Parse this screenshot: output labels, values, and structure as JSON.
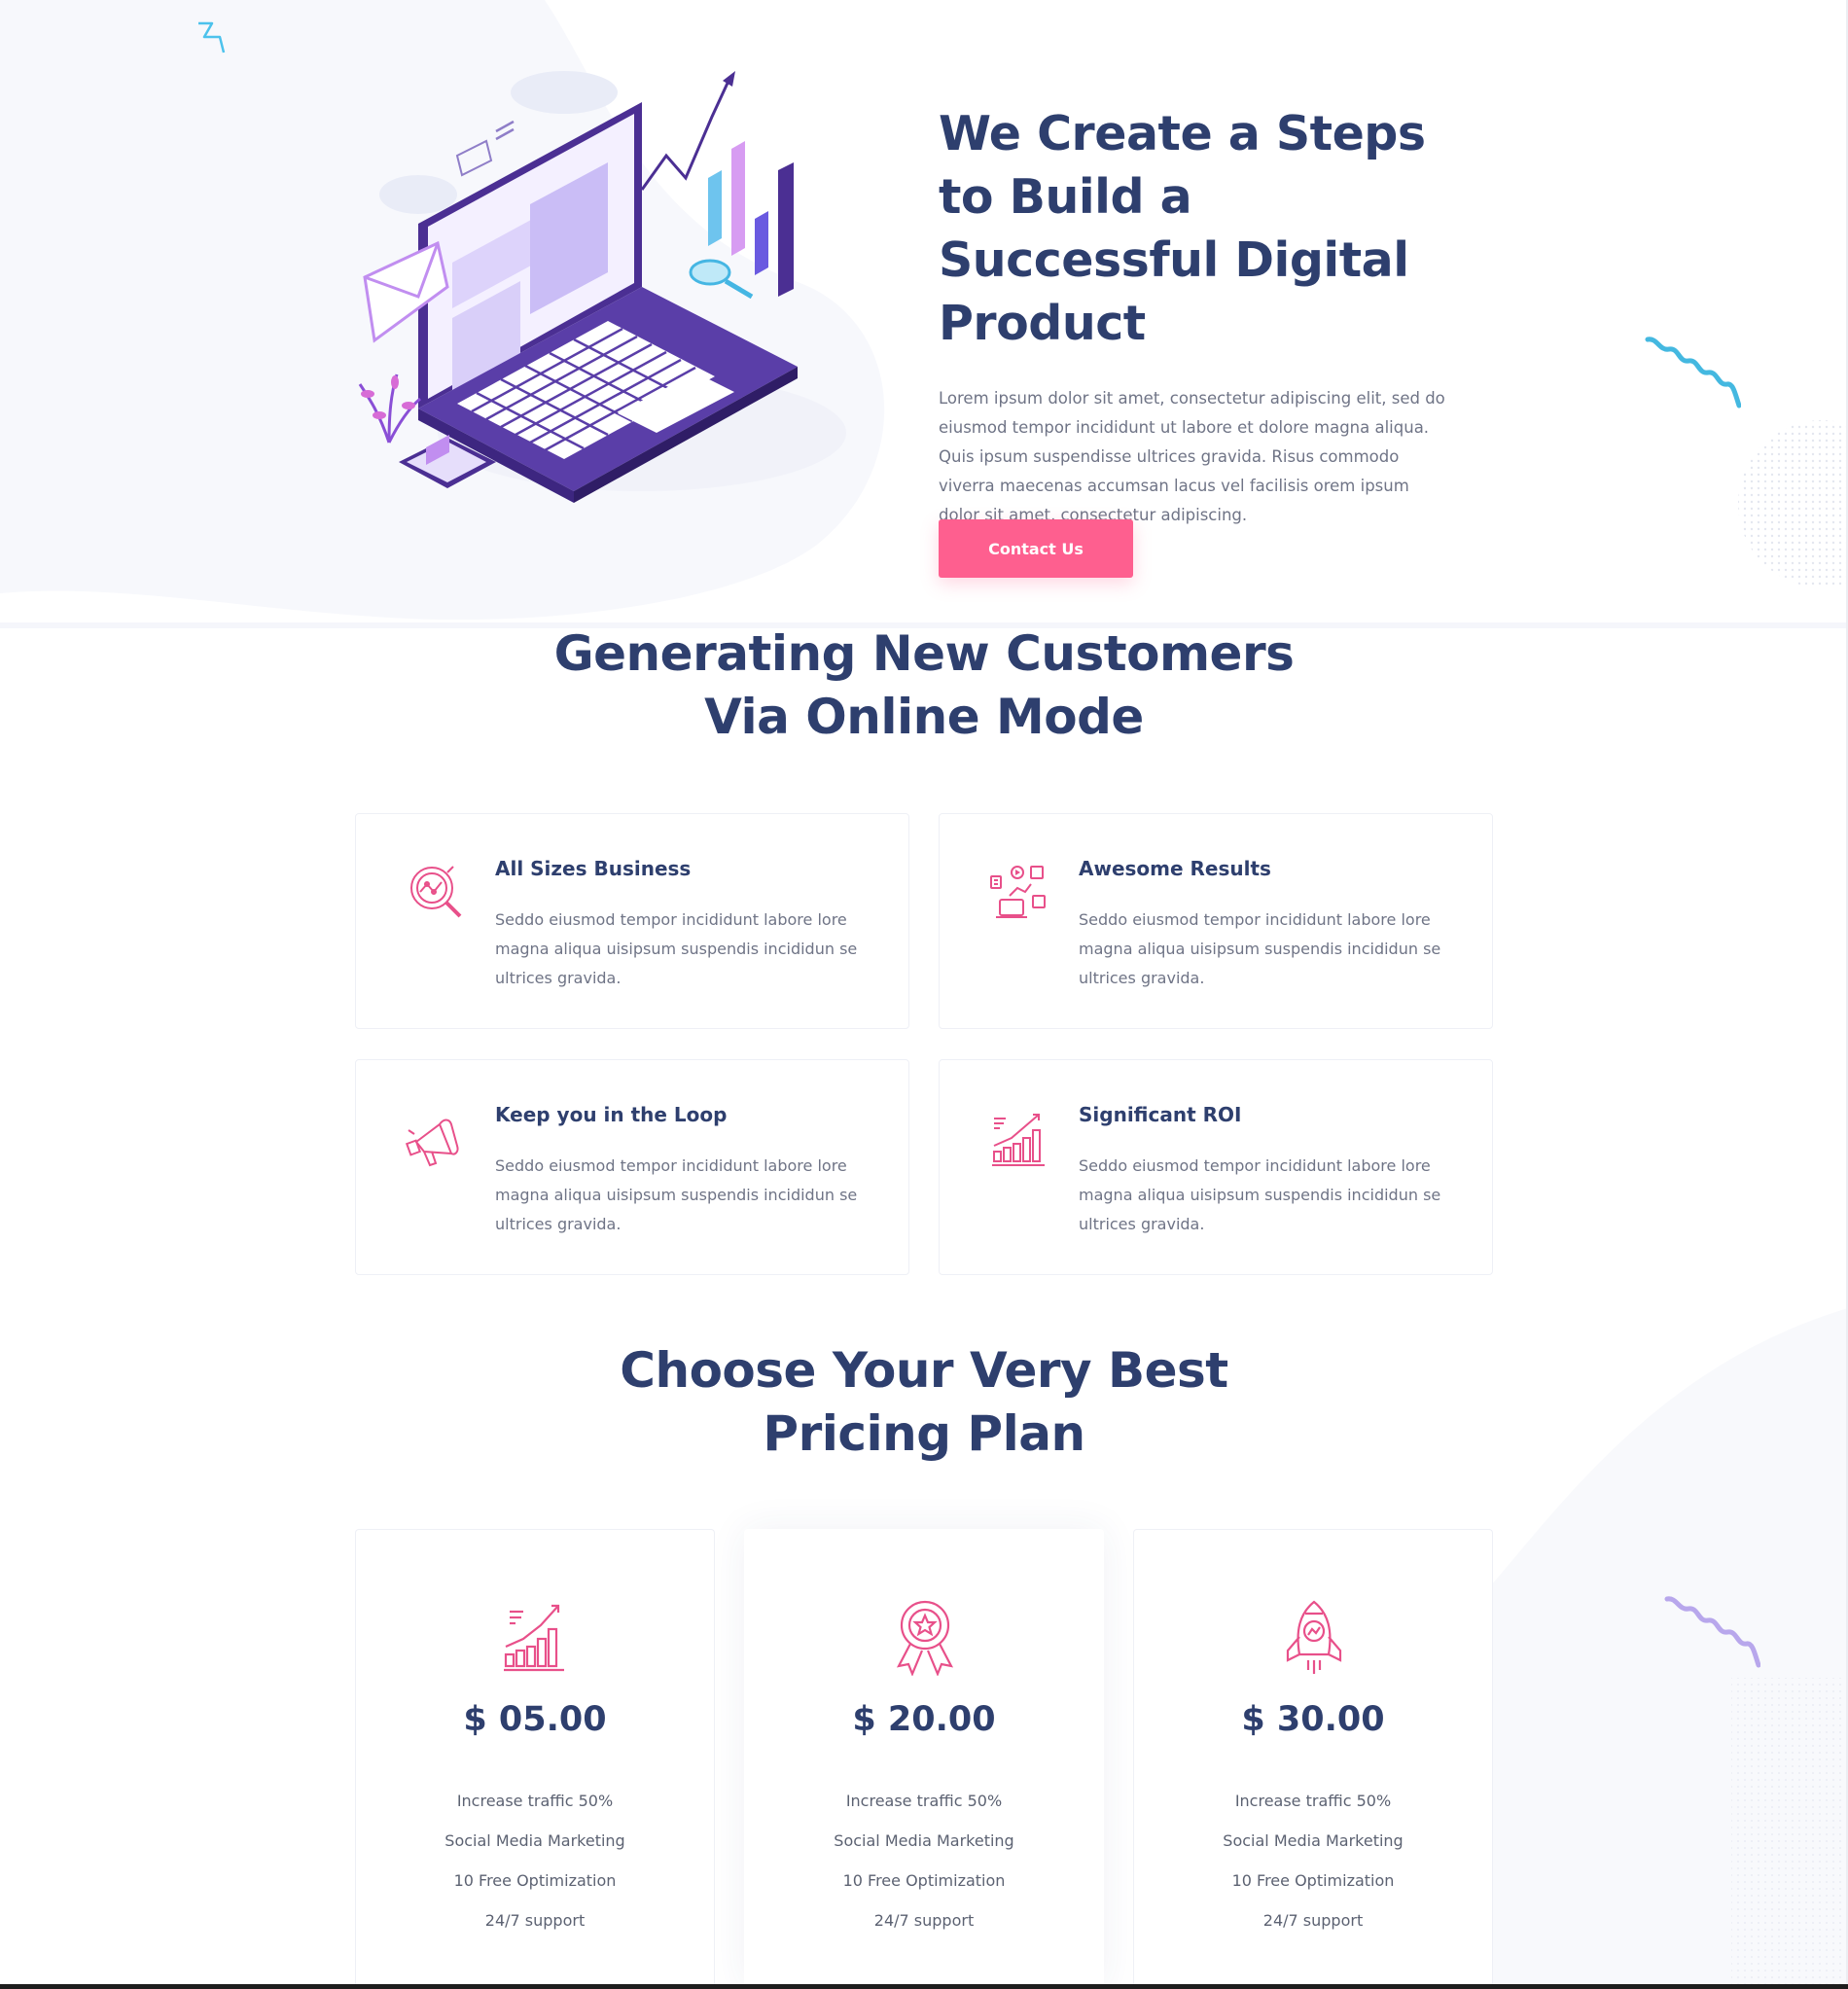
{
  "hero": {
    "title": "We Create a Steps to Build a Successful Digital Product",
    "description": "Lorem ipsum dolor sit amet, consectetur adipiscing elit, sed do eiusmod tempor incididunt ut labore et dolore magna aliqua. Quis ipsum suspendisse ultrices gravida. Risus commodo viverra maecenas accumsan lacus vel facilisis orem ipsum dolor sit amet, consectetur adipiscing.",
    "cta_label": "Contact Us"
  },
  "services": {
    "title_line1": "Generating New Customers",
    "title_line2": "Via Online Mode",
    "cards": [
      {
        "title": "All Sizes Business",
        "text": "Seddo eiusmod tempor incididunt labore lore magna aliqua uisipsum suspendis incididun se ultrices gravida.",
        "icon": "magnifier-chart-icon"
      },
      {
        "title": "Awesome Results",
        "text": "Seddo eiusmod tempor incididunt labore lore magna aliqua uisipsum suspendis incididun se ultrices gravida.",
        "icon": "social-marketing-icon"
      },
      {
        "title": "Keep you in the Loop",
        "text": "Seddo eiusmod tempor incididunt labore lore magna aliqua uisipsum suspendis incididun se ultrices gravida.",
        "icon": "megaphone-icon"
      },
      {
        "title": "Significant ROI",
        "text": "Seddo eiusmod tempor incididunt labore lore magna aliqua uisipsum suspendis incididun se ultrices gravida.",
        "icon": "growth-chart-icon"
      }
    ]
  },
  "pricing": {
    "title_line1": "Choose Your Very Best",
    "title_line2": "Pricing Plan",
    "plans": [
      {
        "price": "$ 05.00",
        "icon": "growth-chart-icon",
        "features": [
          "Increase traffic 50%",
          "Social Media Marketing",
          "10 Free Optimization",
          "24/7 support"
        ]
      },
      {
        "price": "$ 20.00",
        "icon": "award-badge-icon",
        "features": [
          "Increase traffic 50%",
          "Social Media Marketing",
          "10 Free Optimization",
          "24/7 support"
        ]
      },
      {
        "price": "$ 30.00",
        "icon": "rocket-icon",
        "features": [
          "Increase traffic 50%",
          "Social Media Marketing",
          "10 Free Optimization",
          "24/7 support"
        ]
      }
    ]
  },
  "colors": {
    "heading": "#2e3f6e",
    "body_text": "#6f7486",
    "accent_pink": "#fe5f8f",
    "illustration_purple": "#5a3ea8",
    "deco_blue": "#44b8e0",
    "deco_lavender": "#b8a7ec"
  }
}
